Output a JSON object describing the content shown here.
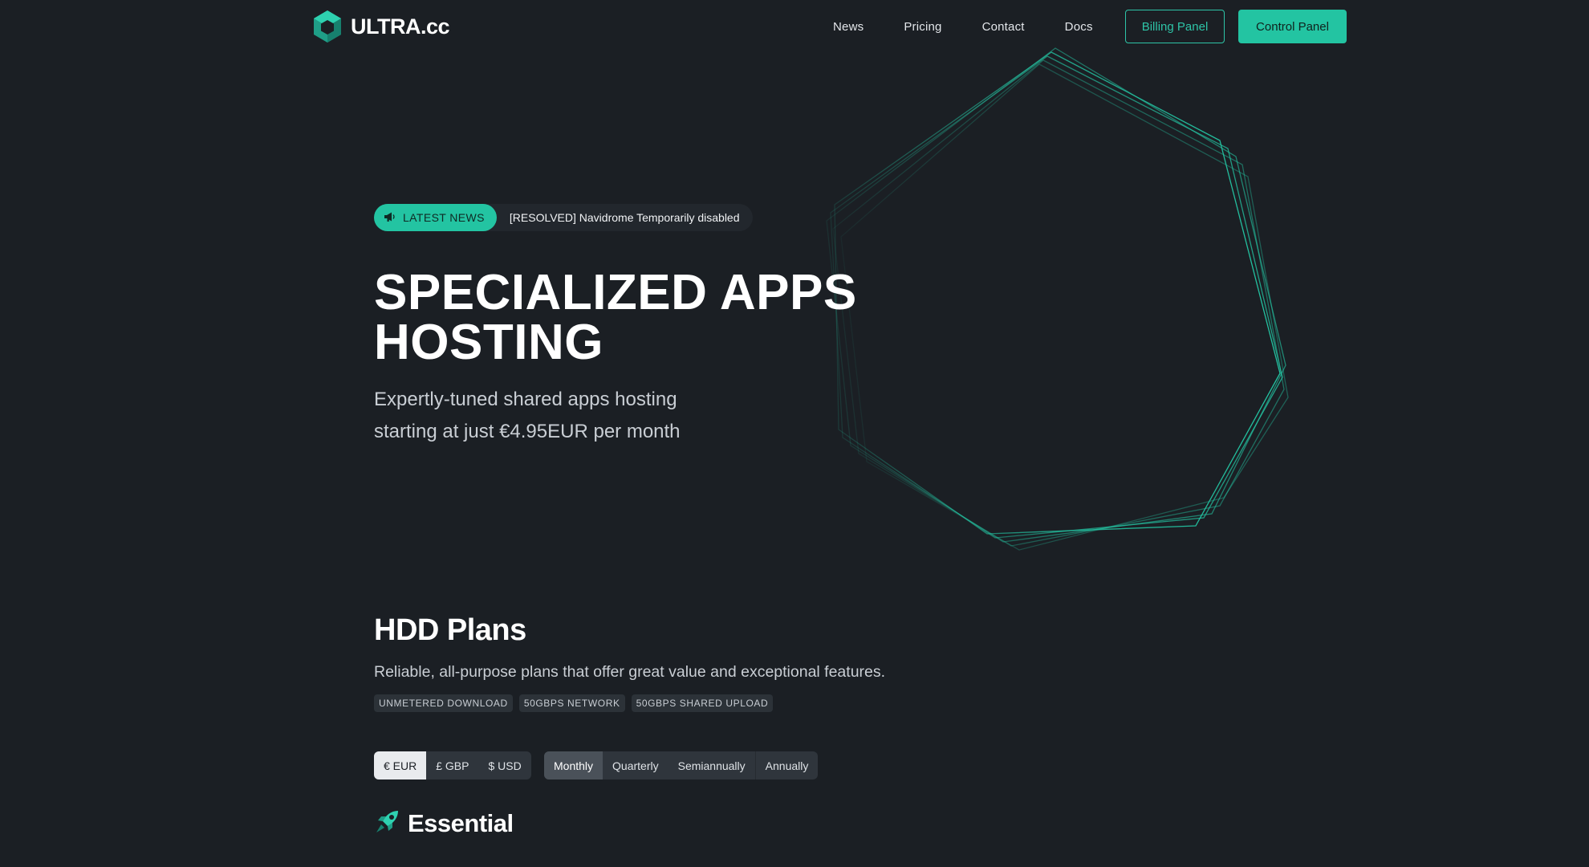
{
  "brand": {
    "name": "ULTRA.cc",
    "accent": "#23c4a2",
    "background": "#1b1f24"
  },
  "nav": {
    "links": [
      "News",
      "Pricing",
      "Contact",
      "Docs"
    ],
    "billing_label": "Billing Panel",
    "control_label": "Control Panel"
  },
  "news": {
    "badge_icon": "megaphone-icon",
    "badge_label": "LATEST NEWS",
    "headline": "[RESOLVED] Navidrome Temporarily disabled"
  },
  "hero": {
    "title_line1": "SPECIALIZED APPS",
    "title_line2": "HOSTING",
    "subtitle_line1": "Expertly-tuned shared apps hosting",
    "subtitle_line2": "starting at just €4.95EUR per month"
  },
  "plans": {
    "title": "HDD Plans",
    "description": "Reliable, all-purpose plans that offer great value and exceptional features.",
    "tags": [
      "UNMETERED DOWNLOAD",
      "50GBPS NETWORK",
      "50GBPS SHARED UPLOAD"
    ],
    "currencies": [
      "€ EUR",
      "£ GBP",
      "$ USD"
    ],
    "selected_currency": "€ EUR",
    "periods": [
      "Monthly",
      "Quarterly",
      "Semiannually",
      "Annually"
    ],
    "selected_period": "Monthly",
    "first_plan": {
      "icon": "rocket-icon",
      "name": "Essential"
    }
  }
}
